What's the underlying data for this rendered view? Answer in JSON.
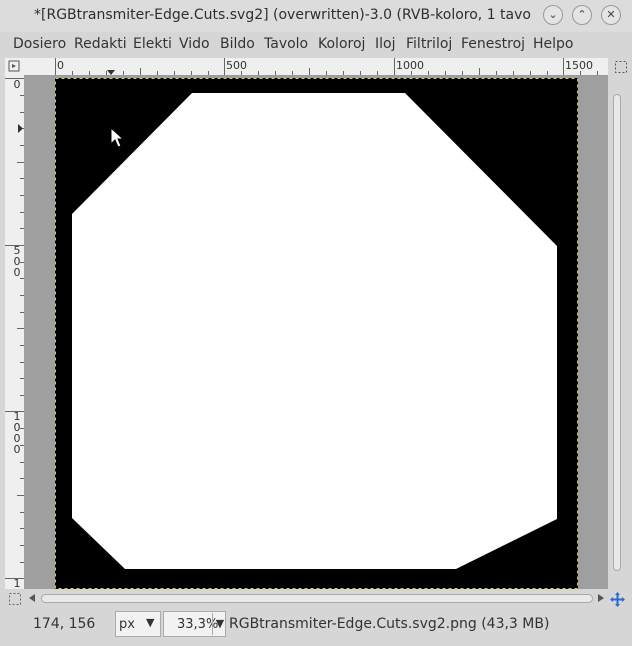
{
  "window": {
    "title": "*[RGBtransmiter-Edge.Cuts.svg2] (overwritten)-3.0 (RVB-koloro, 1 tavolo)",
    "minimize_glyph": "⌄",
    "maximize_glyph": "⌃",
    "close_glyph": "✕"
  },
  "menubar": {
    "items": [
      "Dosiero",
      "Redakti",
      "Elekti",
      "Vido",
      "Bildo",
      "Tavolo",
      "Koloroj",
      "Iloj",
      "Filtriloj",
      "Fenestroj",
      "Helpo"
    ]
  },
  "hruler": {
    "labels": [
      "0",
      "500",
      "1000",
      "1500"
    ]
  },
  "vruler": {
    "labels": [
      {
        "chars": [
          "0"
        ]
      },
      {
        "chars": [
          "5",
          "0",
          "0"
        ]
      },
      {
        "chars": [
          "1",
          "0",
          "0",
          "0"
        ]
      },
      {
        "chars": [
          "1"
        ]
      }
    ]
  },
  "status": {
    "coordinates": "174, 156",
    "unit": "px",
    "zoom": "33,3%",
    "file_info": "RGBtransmiter-Edge.Cuts.svg2.png (43,3 MB)"
  },
  "icons": {
    "pointer": "mouse-pointer-icon",
    "ruler_toggle": "quick-mask-icon",
    "zoom_fit": "zoom-fit-icon",
    "navigate": "navigate-icon"
  },
  "colors": {
    "image_background": "#000000",
    "shape_fill": "#ffffff",
    "canvas_bg": "#9f9f9f"
  }
}
